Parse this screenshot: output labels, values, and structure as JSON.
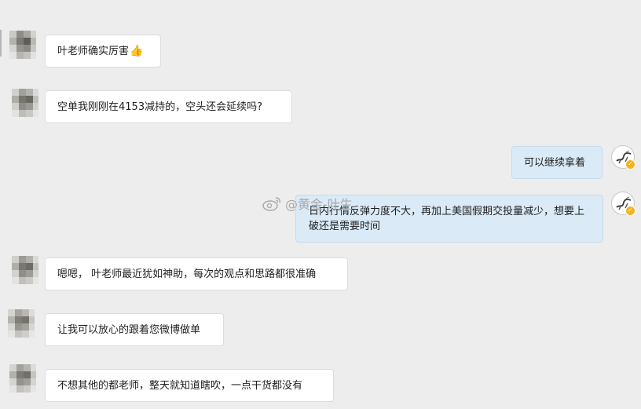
{
  "messages": [
    {
      "side": "left",
      "text": "叶老师确实厉害",
      "emoji": "👍"
    },
    {
      "side": "left",
      "text": "空单我刚刚在4153减持的，空头还会延续吗?"
    },
    {
      "side": "right",
      "text": "可以继续拿着"
    },
    {
      "side": "right",
      "text": "日内行情反弹力度不大，再加上美国假期交投量减少，想要上破还是需要时间"
    },
    {
      "side": "left",
      "text": "嗯嗯， 叶老师最近犹如神助，每次的观点和思路都很准确"
    },
    {
      "side": "left",
      "text": "让我可以放心的跟着您微博做单"
    },
    {
      "side": "left",
      "text": "不想其他的都老师，整天就知道瞎吹，一点干货都没有"
    }
  ],
  "watermark": {
    "text": "@黄金-叶生"
  },
  "icons": {
    "left_avatar": "blurred-avatar-icon",
    "right_avatar": "bamboo-avatar-icon",
    "badge": "verified-badge-icon",
    "watermark_logo": "weibo-logo-icon"
  },
  "colors": {
    "background": "#ededed",
    "left_bubble": "#ffffff",
    "right_bubble": "#daeaf7",
    "verified_badge": "#f3b31a"
  }
}
